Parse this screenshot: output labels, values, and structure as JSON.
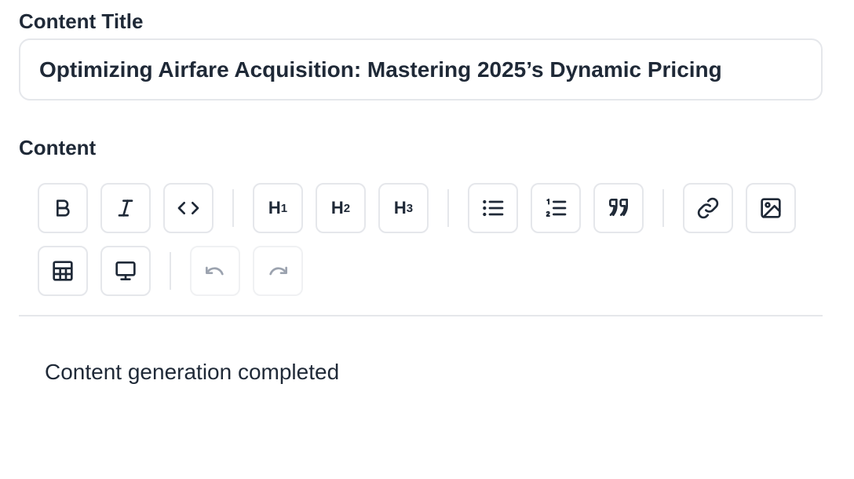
{
  "title_field": {
    "label": "Content Title",
    "value": "Optimizing Airfare Acquisition: Mastering 2025’s Dynamic Pricing"
  },
  "content_field": {
    "label": "Content",
    "body_text": "Content generation completed"
  },
  "toolbar": {
    "bold_icon": "bold-icon",
    "italic_icon": "italic-icon",
    "code_icon": "code-icon",
    "h1": {
      "letter": "H",
      "level": "1"
    },
    "h2": {
      "letter": "H",
      "level": "2"
    },
    "h3": {
      "letter": "H",
      "level": "3"
    },
    "bullet_list_icon": "bullet-list-icon",
    "ordered_list_icon": "ordered-list-icon",
    "blockquote_icon": "quote-icon",
    "link_icon": "link-icon",
    "image_icon": "image-icon",
    "table_icon": "table-icon",
    "embed_icon": "monitor-icon",
    "undo_icon": "undo-icon",
    "redo_icon": "redo-icon",
    "undo_enabled": false,
    "redo_enabled": false
  },
  "colors": {
    "text": "#1f2937",
    "border": "#e5e7eb",
    "disabled": "#9ca3af"
  }
}
